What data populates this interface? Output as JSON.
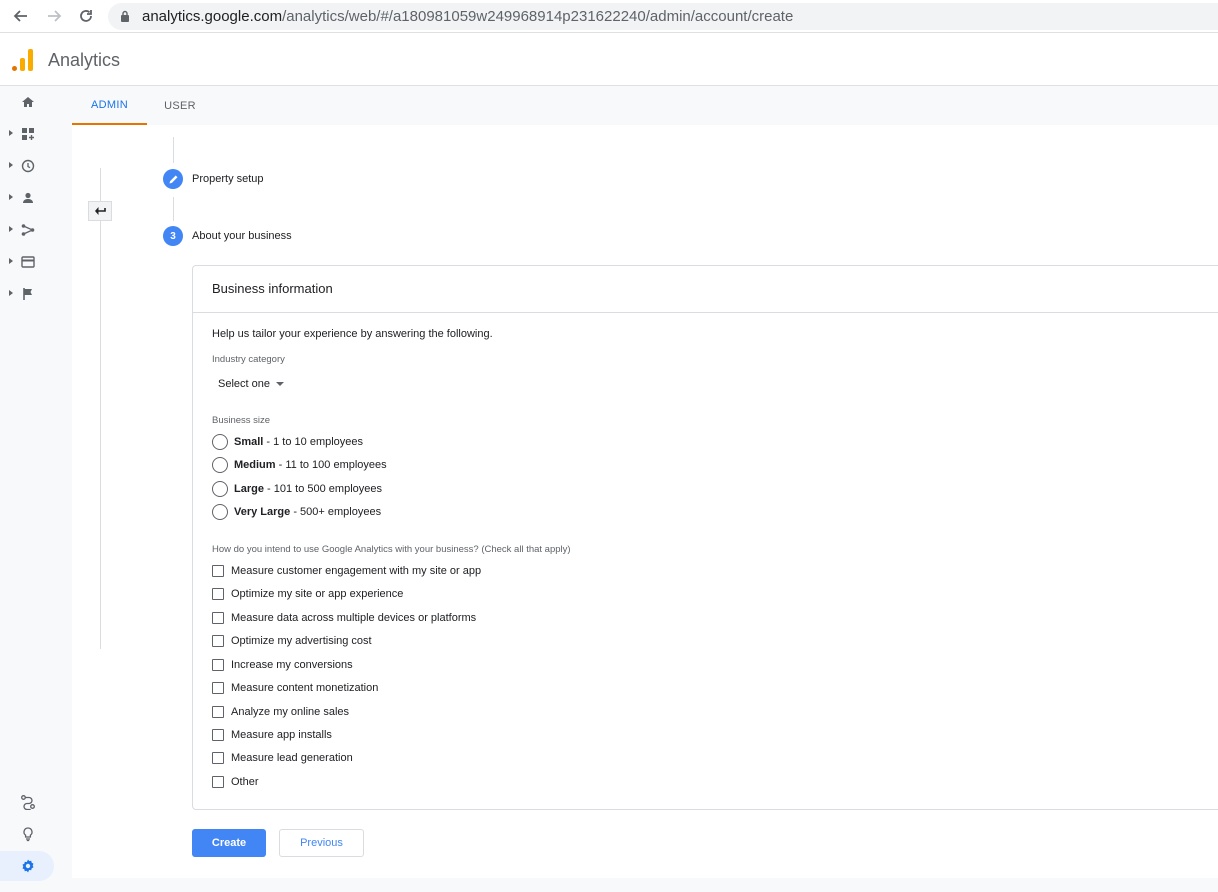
{
  "browser": {
    "url_host": "analytics.google.com",
    "url_path": "/analytics/web/#/a180981059w249968914p231622240/admin/account/create"
  },
  "app": {
    "title": "Analytics",
    "brand_colors": {
      "orange_dark": "#e37400",
      "orange_light": "#f9ab00",
      "blue": "#4285f4"
    }
  },
  "rail": {
    "items": [
      {
        "icon": "home-icon"
      },
      {
        "icon": "dashboard-icon"
      },
      {
        "icon": "realtime-clock-icon"
      },
      {
        "icon": "audience-person-icon"
      },
      {
        "icon": "acquisition-icon"
      },
      {
        "icon": "behavior-icon"
      },
      {
        "icon": "conversions-flag-icon"
      }
    ],
    "bottom": [
      {
        "icon": "attribution-icon"
      },
      {
        "icon": "discover-lightbulb-icon"
      },
      {
        "icon": "admin-gear-icon",
        "active": true
      }
    ]
  },
  "tabs": [
    {
      "label": "ADMIN",
      "active": true
    },
    {
      "label": "USER",
      "active": false
    }
  ],
  "steps": [
    {
      "label": "Property setup",
      "state": "edit"
    },
    {
      "label": "About your business",
      "number": "3",
      "state": "current"
    }
  ],
  "card": {
    "title": "Business information",
    "intro": "Help us tailor your experience by answering the following.",
    "industry_label": "Industry category",
    "industry_value": "Select one",
    "size_label": "Business size",
    "sizes": [
      {
        "name": "Small",
        "desc": " - 1 to 10 employees"
      },
      {
        "name": "Medium",
        "desc": " - 11 to 100 employees"
      },
      {
        "name": "Large",
        "desc": " - 101 to 500 employees"
      },
      {
        "name": "Very Large",
        "desc": " - 500+ employees"
      }
    ],
    "usage_label": "How do you intend to use Google Analytics with your business? (Check all that apply)",
    "usages": [
      "Measure customer engagement with my site or app",
      "Optimize my site or app experience",
      "Measure data across multiple devices or platforms",
      "Optimize my advertising cost",
      "Increase my conversions",
      "Measure content monetization",
      "Analyze my online sales",
      "Measure app installs",
      "Measure lead generation",
      "Other"
    ]
  },
  "buttons": {
    "create": "Create",
    "previous": "Previous"
  }
}
